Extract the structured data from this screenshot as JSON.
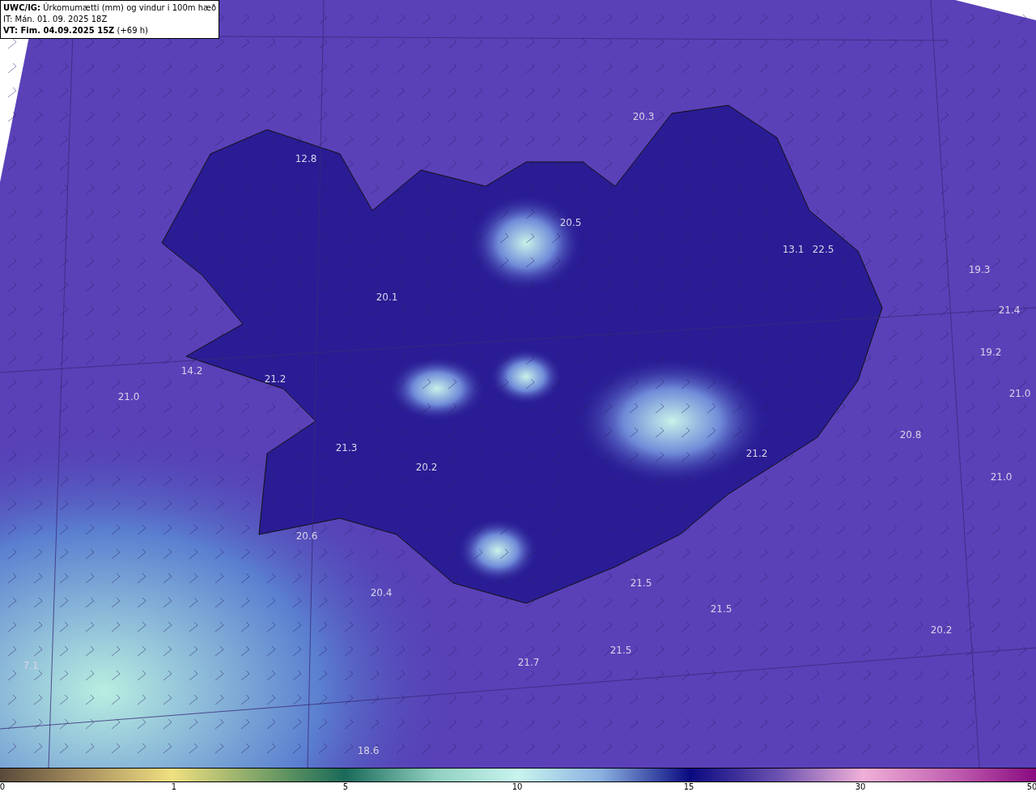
{
  "header": {
    "title": "**UWC/IG:** Úrkomumætti (mm) og vindur i 100m hæð",
    "issue_time": "IT: Mán. 01. 09. 2025 18Z",
    "valid_time": "**VT: Fim. 04.09.2025 15Z** (+69 h)"
  },
  "map_labels": [
    "20.3",
    "12.8",
    "20.5",
    "13.1",
    "22.5",
    "19.3",
    "20.1",
    "21.4",
    "19.2",
    "14.2",
    "21.2",
    "21.0",
    "21.0",
    "20.8",
    "21.3",
    "21.2",
    "20.2",
    "21.0",
    "20.6",
    "21.5",
    "20.4",
    "21.5",
    "20.2",
    "21.5",
    "21.7",
    "7.1",
    "18.6"
  ],
  "colorbar": {
    "ticks": [
      "0",
      "1",
      "5",
      "10",
      "15",
      "30",
      "50"
    ]
  }
}
